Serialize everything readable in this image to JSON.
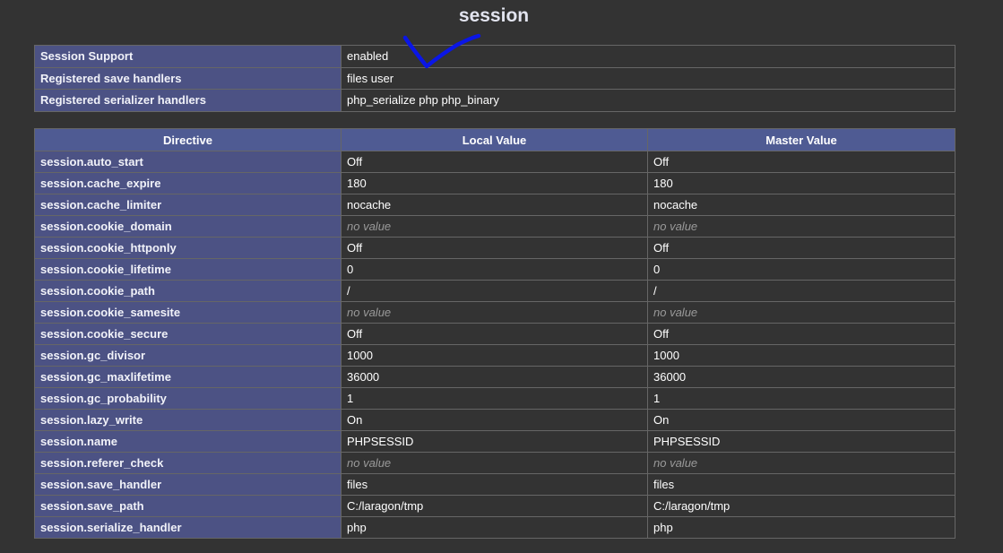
{
  "title": "session",
  "info_rows": [
    {
      "name": "Session Support",
      "value": "enabled"
    },
    {
      "name": "Registered save handlers",
      "value": "files user"
    },
    {
      "name": "Registered serializer handlers",
      "value": "php_serialize php php_binary"
    }
  ],
  "headers": [
    "Directive",
    "Local Value",
    "Master Value"
  ],
  "directives": [
    {
      "name": "session.auto_start",
      "local": "Off",
      "master": "Off"
    },
    {
      "name": "session.cache_expire",
      "local": "180",
      "master": "180"
    },
    {
      "name": "session.cache_limiter",
      "local": "nocache",
      "master": "nocache"
    },
    {
      "name": "session.cookie_domain",
      "local": "no value",
      "master": "no value"
    },
    {
      "name": "session.cookie_httponly",
      "local": "Off",
      "master": "Off"
    },
    {
      "name": "session.cookie_lifetime",
      "local": "0",
      "master": "0"
    },
    {
      "name": "session.cookie_path",
      "local": "/",
      "master": "/"
    },
    {
      "name": "session.cookie_samesite",
      "local": "no value",
      "master": "no value"
    },
    {
      "name": "session.cookie_secure",
      "local": "Off",
      "master": "Off"
    },
    {
      "name": "session.gc_divisor",
      "local": "1000",
      "master": "1000"
    },
    {
      "name": "session.gc_maxlifetime",
      "local": "36000",
      "master": "36000"
    },
    {
      "name": "session.gc_probability",
      "local": "1",
      "master": "1"
    },
    {
      "name": "session.lazy_write",
      "local": "On",
      "master": "On"
    },
    {
      "name": "session.name",
      "local": "PHPSESSID",
      "master": "PHPSESSID"
    },
    {
      "name": "session.referer_check",
      "local": "no value",
      "master": "no value"
    },
    {
      "name": "session.save_handler",
      "local": "files",
      "master": "files"
    },
    {
      "name": "session.save_path",
      "local": "C:/laragon/tmp",
      "master": "C:/laragon/tmp"
    },
    {
      "name": "session.serialize_handler",
      "local": "php",
      "master": "php"
    }
  ],
  "colors": {
    "background": "#333333",
    "header": "#4f5b93",
    "name_cell": "#4c5284",
    "annotation": "#0a16e6"
  },
  "annotation_icon": "checkmark-icon"
}
